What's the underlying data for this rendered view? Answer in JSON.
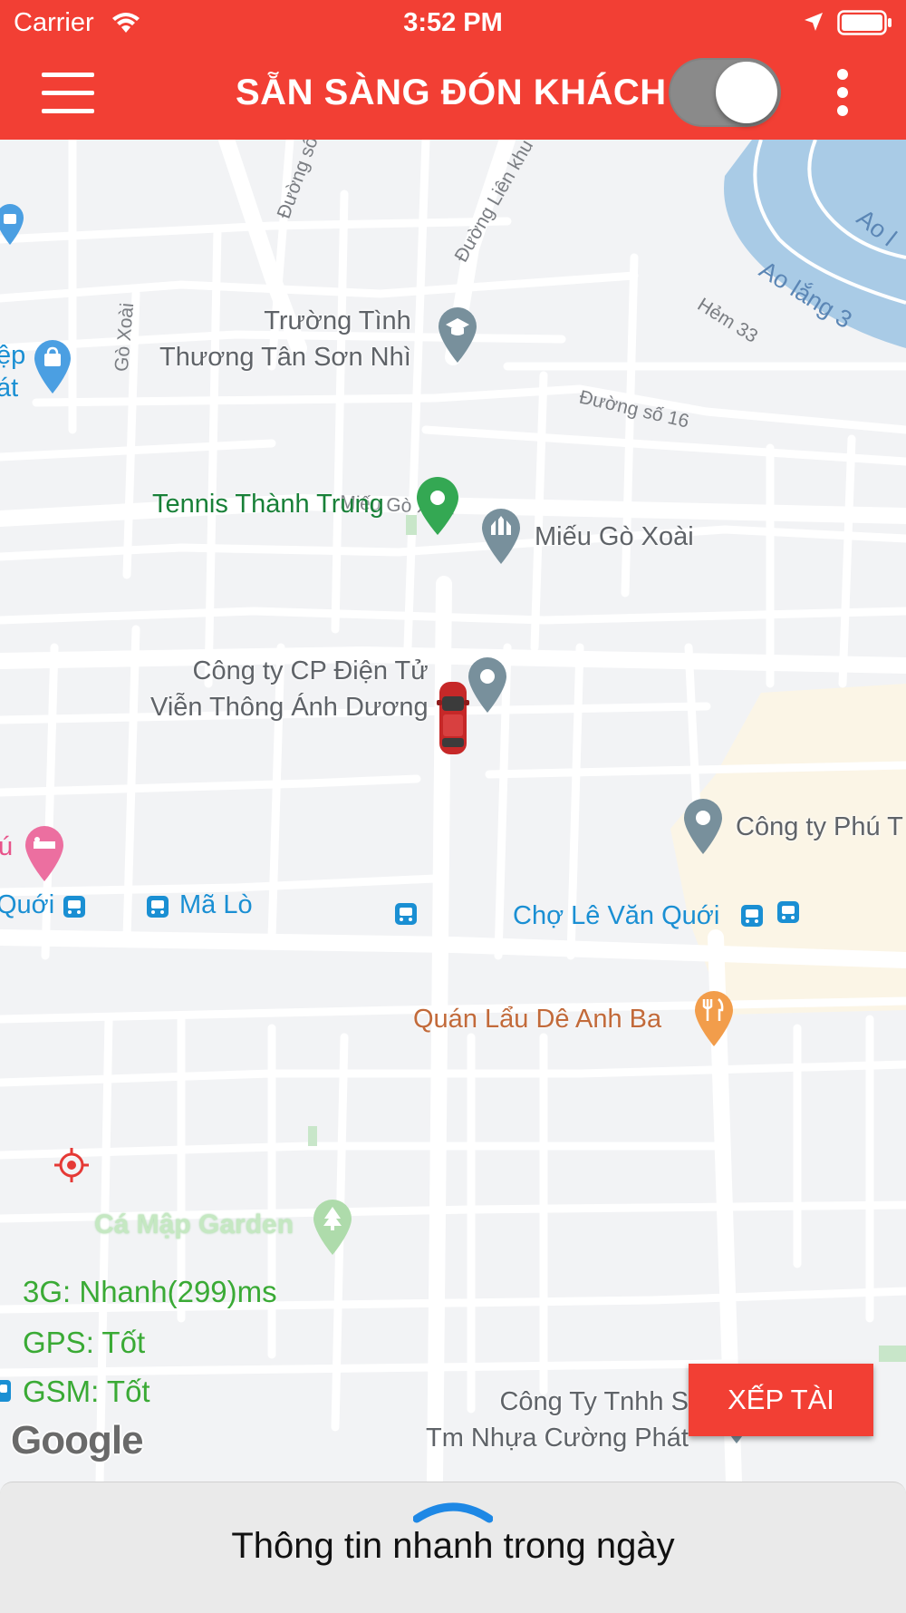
{
  "status_bar": {
    "carrier": "Carrier",
    "time": "3:52 PM"
  },
  "app_bar": {
    "title": "SẴN SÀNG ĐÓN KHÁCH",
    "online_toggle": true
  },
  "colors": {
    "primary": "#f23f34",
    "status_green": "#3aaa35",
    "river": "#a9cbe6",
    "poi_gray": "#78909c",
    "link_blue": "#1a8fd3"
  },
  "map": {
    "places": [
      {
        "id": "school",
        "name": "Trường Tình\nThương Tân Sơn Nhì",
        "icon": "school-icon"
      },
      {
        "id": "tennis",
        "name": "Tennis Thành Trung",
        "icon": "green-pin-icon"
      },
      {
        "id": "temple",
        "name": "Miếu Gò Xoài",
        "icon": "temple-icon"
      },
      {
        "id": "company1",
        "name": "Công ty CP Điện Tử\nViễn Thông Ánh Dương",
        "icon": "place-pin-icon"
      },
      {
        "id": "company2",
        "name": "Công ty Phú T",
        "icon": "place-pin-icon"
      },
      {
        "id": "restaurant",
        "name": "Quán Lẩu Dê Anh Ba",
        "icon": "restaurant-icon"
      },
      {
        "id": "garden",
        "name": "Cá Mập Garden",
        "icon": "park-icon"
      },
      {
        "id": "company3",
        "name": "Công Ty Tnhh S\nTm Nhựa Cường Phát",
        "icon": "place-pin-icon"
      },
      {
        "id": "shop",
        "name": "ệp\nát",
        "icon": "shopping-icon"
      },
      {
        "id": "hotel",
        "name": "ú",
        "icon": "hotel-icon"
      }
    ],
    "bus_stops": [
      {
        "id": "stop1",
        "name": "Quới"
      },
      {
        "id": "stop2",
        "name": "Mã Lò"
      },
      {
        "id": "stop3",
        "name": "Chợ Lê Văn Quới"
      }
    ],
    "roads": [
      "Đường số",
      "Đường Liên khu",
      "Hẻm 33",
      "Đường số 16",
      "Gò Xoài",
      "Miếu Gò Xoài"
    ],
    "river_label": "Ao lắng 3",
    "river_label_2": "Ao l",
    "attribution": "Google"
  },
  "network_status": [
    {
      "label": "3G: Nhanh(299)ms"
    },
    {
      "label": "GPS: Tốt"
    },
    {
      "label": "GSM: Tốt"
    }
  ],
  "assign_button": "XẾP TÀI",
  "bottom_sheet": {
    "title": "Thông tin nhanh trong ngày"
  }
}
